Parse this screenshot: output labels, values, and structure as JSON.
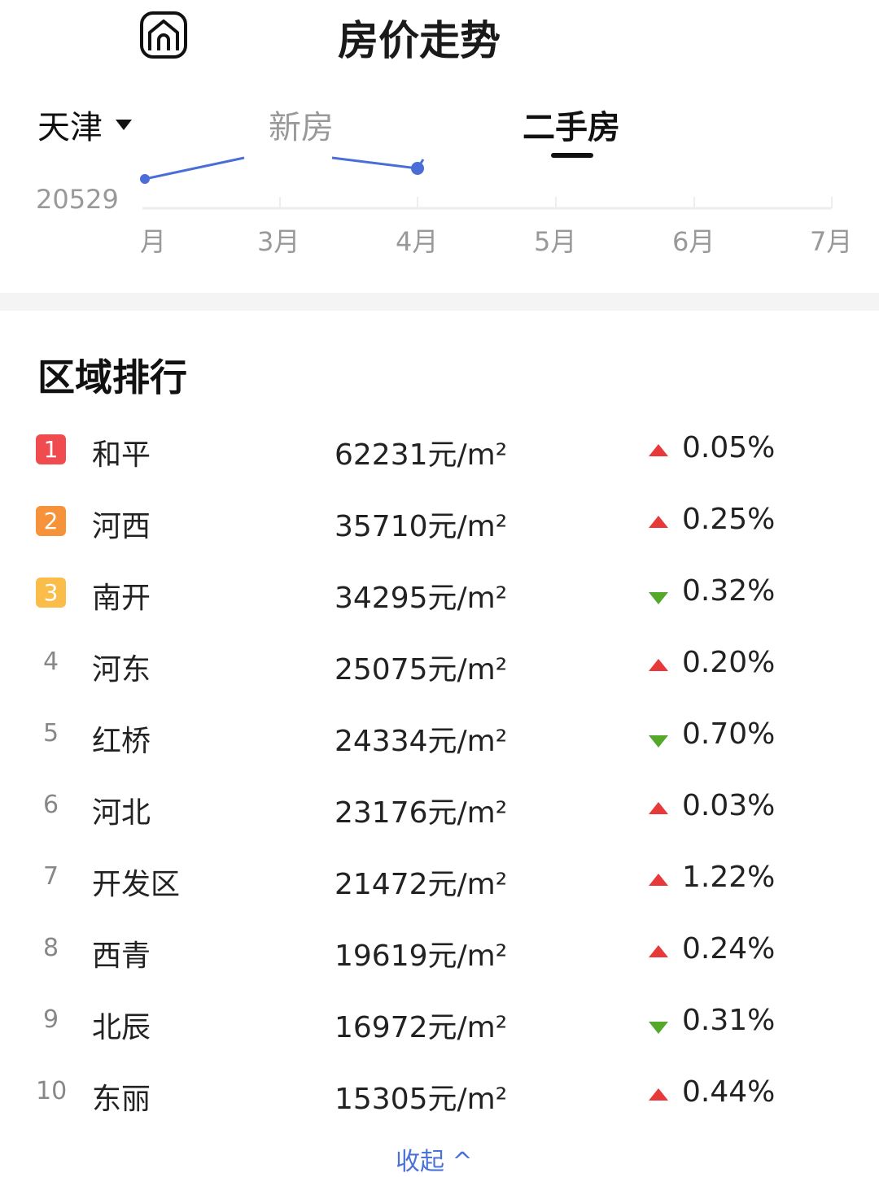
{
  "header": {
    "title": "房价走势",
    "home_icon": "home-icon"
  },
  "tabs": {
    "city": "天津",
    "items": [
      {
        "label": "新房",
        "active": false
      },
      {
        "label": "二手房",
        "active": true
      }
    ]
  },
  "chart_data": {
    "type": "line",
    "y_label_visible": "20529",
    "x_ticks": [
      "月",
      "3月",
      "4月",
      "5月",
      "6月",
      "7月"
    ],
    "series_color": "#4b6ed6"
  },
  "ranking": {
    "title": "区域排行",
    "rows": [
      {
        "rank": "1",
        "name": "和平",
        "price": "62231元/m²",
        "direction": "up",
        "change": "0.05%",
        "badge_color": "#f04b4f"
      },
      {
        "rank": "2",
        "name": "河西",
        "price": "35710元/m²",
        "direction": "up",
        "change": "0.25%",
        "badge_color": "#f5923a"
      },
      {
        "rank": "3",
        "name": "南开",
        "price": "34295元/m²",
        "direction": "down",
        "change": "0.32%",
        "badge_color": "#fbbd4a"
      },
      {
        "rank": "4",
        "name": "河东",
        "price": "25075元/m²",
        "direction": "up",
        "change": "0.20%"
      },
      {
        "rank": "5",
        "name": "红桥",
        "price": "24334元/m²",
        "direction": "down",
        "change": "0.70%"
      },
      {
        "rank": "6",
        "name": "河北",
        "price": "23176元/m²",
        "direction": "up",
        "change": "0.03%"
      },
      {
        "rank": "7",
        "name": "开发区",
        "price": "21472元/m²",
        "direction": "up",
        "change": "1.22%"
      },
      {
        "rank": "8",
        "name": "西青",
        "price": "19619元/m²",
        "direction": "up",
        "change": "0.24%"
      },
      {
        "rank": "9",
        "name": "北辰",
        "price": "16972元/m²",
        "direction": "down",
        "change": "0.31%"
      },
      {
        "rank": "10",
        "name": "东丽",
        "price": "15305元/m²",
        "direction": "up",
        "change": "0.44%"
      }
    ],
    "collapse_label": "收起 ^"
  },
  "colors": {
    "up": "#e8393a",
    "down": "#54a92d",
    "link": "#4b72d8"
  }
}
